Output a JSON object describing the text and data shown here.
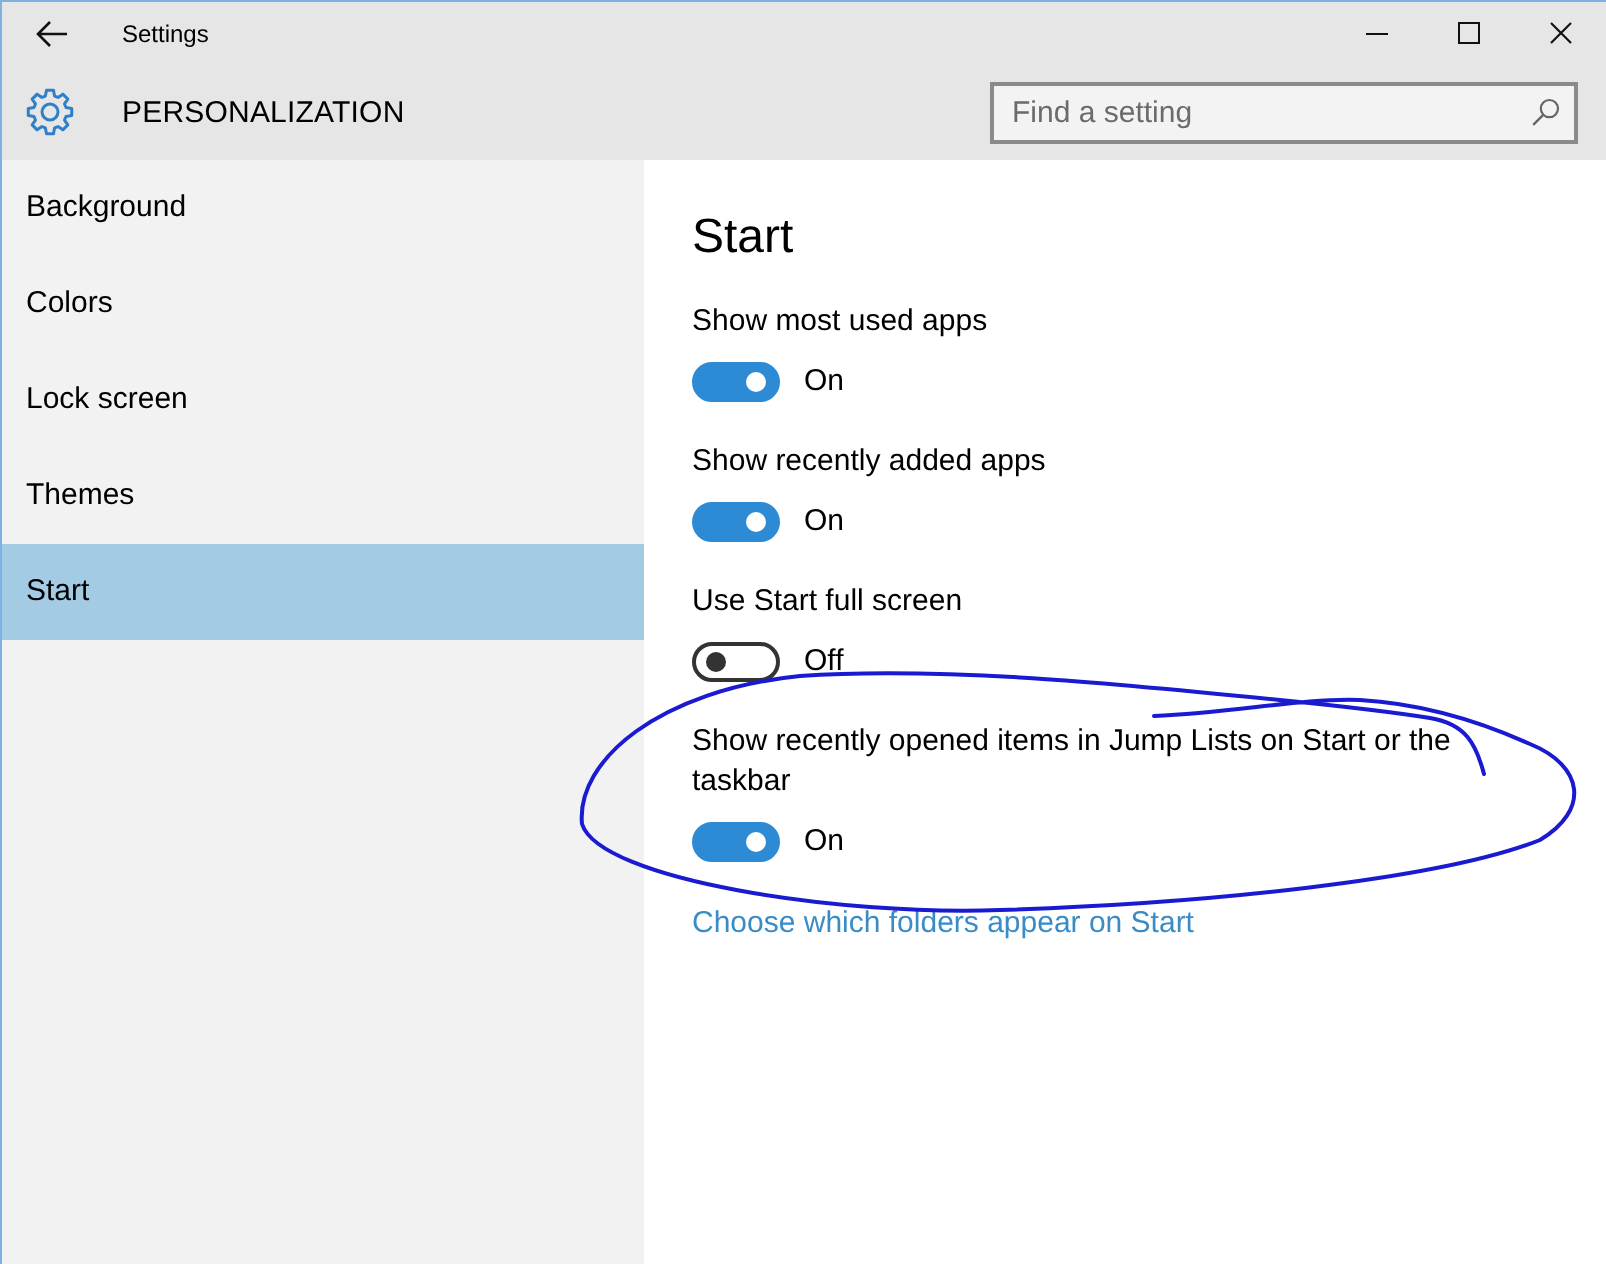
{
  "window": {
    "title": "Settings"
  },
  "header": {
    "title": "PERSONALIZATION",
    "search": {
      "placeholder": "Find a setting"
    }
  },
  "sidebar": {
    "items": [
      {
        "label": "Background",
        "selected": false
      },
      {
        "label": "Colors",
        "selected": false
      },
      {
        "label": "Lock screen",
        "selected": false
      },
      {
        "label": "Themes",
        "selected": false
      },
      {
        "label": "Start",
        "selected": true
      }
    ]
  },
  "content": {
    "title": "Start",
    "settings": [
      {
        "label": "Show most used apps",
        "on": true,
        "state_label": "On",
        "circled": false
      },
      {
        "label": "Show recently added apps",
        "on": true,
        "state_label": "On",
        "circled": false
      },
      {
        "label": "Use Start full screen",
        "on": false,
        "state_label": "Off",
        "circled": false
      },
      {
        "label": "Show recently opened items in Jump Lists on Start or the taskbar",
        "on": true,
        "state_label": "On",
        "circled": true
      }
    ],
    "link": "Choose which folders appear on Start"
  }
}
